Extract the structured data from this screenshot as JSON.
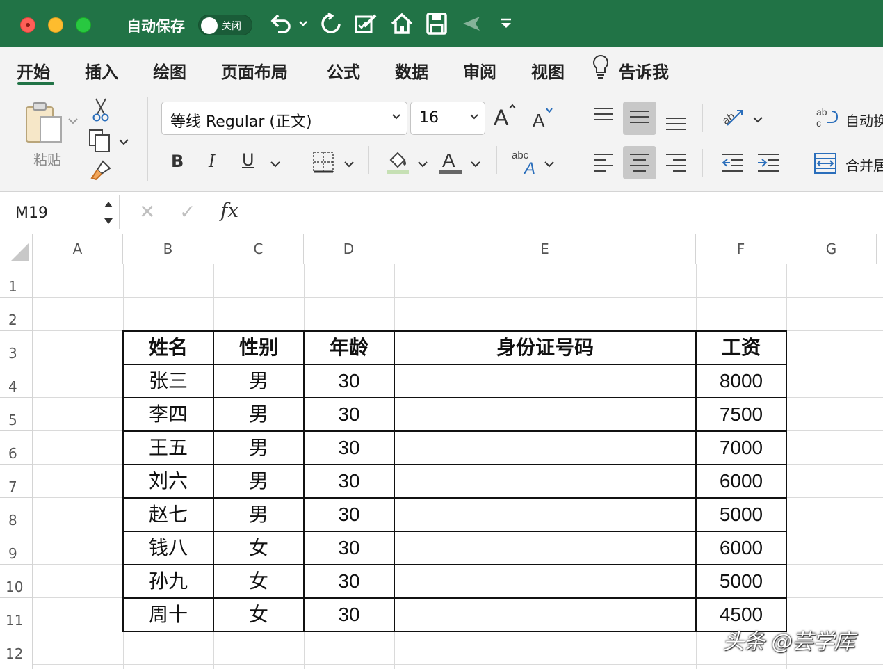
{
  "titlebar": {
    "autosave_label": "自动保存",
    "autosave_state": "关闭"
  },
  "tabs": [
    "开始",
    "插入",
    "绘图",
    "页面布局",
    "公式",
    "数据",
    "审阅",
    "视图",
    "告诉我"
  ],
  "ribbon": {
    "paste_label": "粘贴",
    "font_name": "等线 Regular (正文)",
    "font_size": "16",
    "wrap_text_label": "自动换",
    "merge_label": "合并居"
  },
  "formula_bar": {
    "name_box": "M19",
    "fx_label": "fx"
  },
  "columns": [
    "A",
    "B",
    "C",
    "D",
    "E",
    "F",
    "G"
  ],
  "rows": [
    "1",
    "2",
    "3",
    "4",
    "5",
    "6",
    "7",
    "8",
    "9",
    "10",
    "11",
    "12"
  ],
  "table": {
    "headers": [
      "姓名",
      "性别",
      "年龄",
      "身份证号码",
      "工资"
    ],
    "rows": [
      [
        "张三",
        "男",
        "30",
        "",
        "8000"
      ],
      [
        "李四",
        "男",
        "30",
        "",
        "7500"
      ],
      [
        "王五",
        "男",
        "30",
        "",
        "7000"
      ],
      [
        "刘六",
        "男",
        "30",
        "",
        "6000"
      ],
      [
        "赵七",
        "男",
        "30",
        "",
        "5000"
      ],
      [
        "钱八",
        "女",
        "30",
        "",
        "6000"
      ],
      [
        "孙九",
        "女",
        "30",
        "",
        "5000"
      ],
      [
        "周十",
        "女",
        "30",
        "",
        "4500"
      ]
    ]
  },
  "watermark": "头条 @芸学库"
}
